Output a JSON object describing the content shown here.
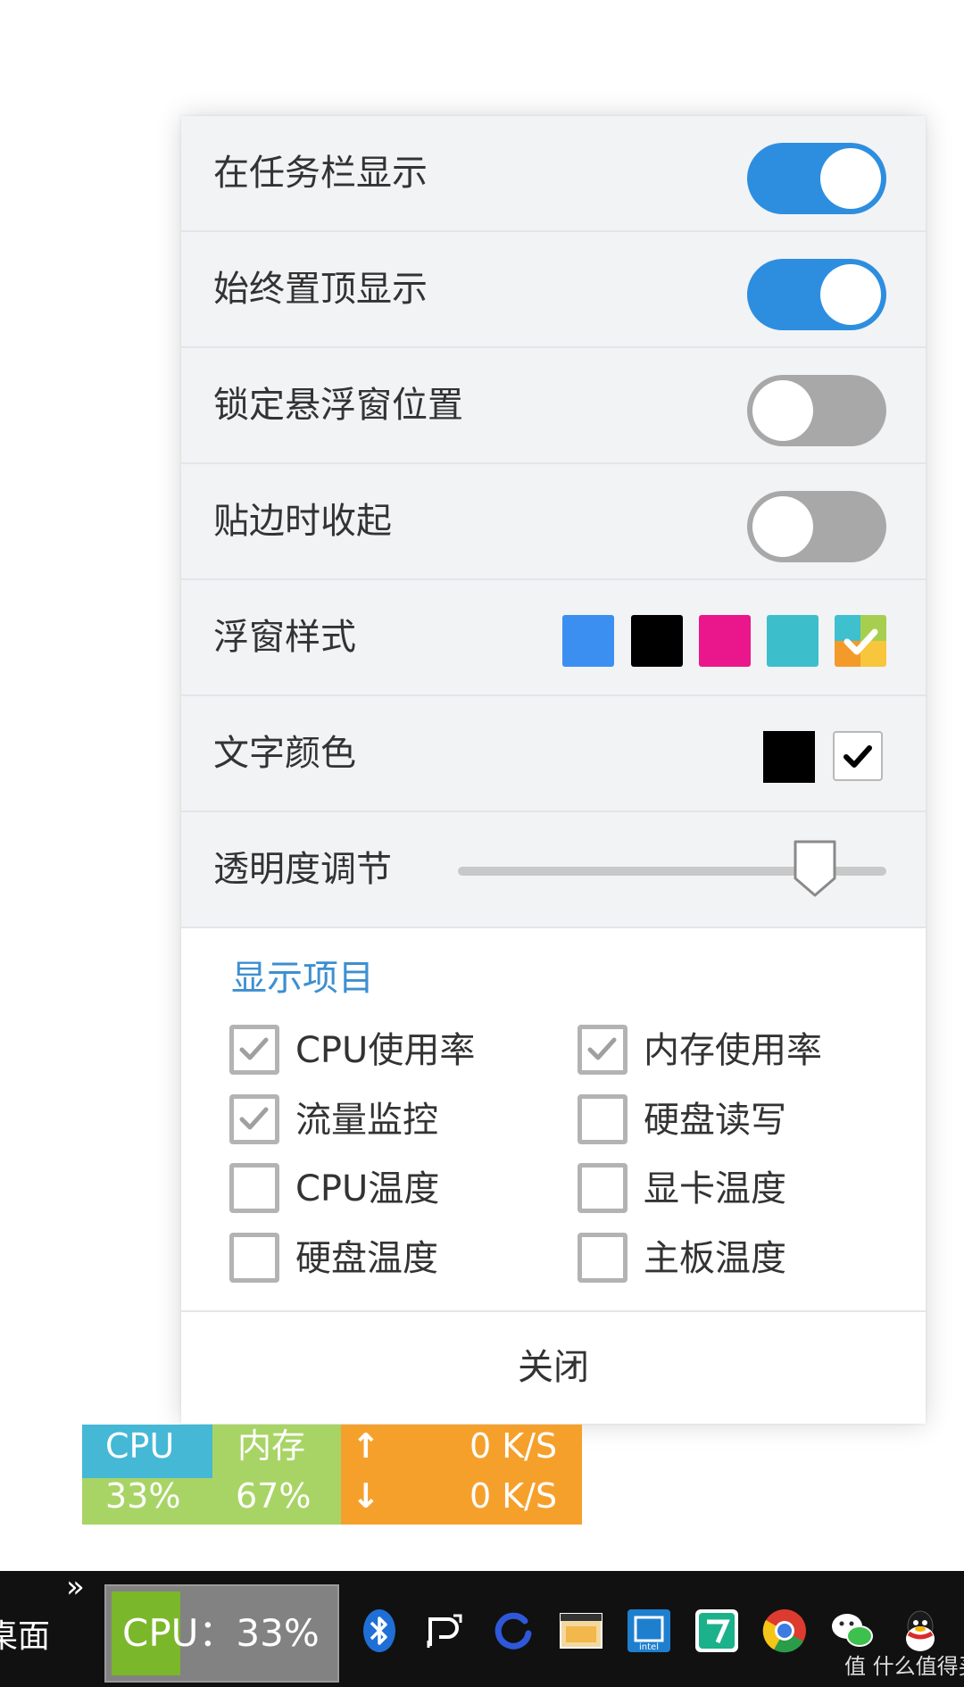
{
  "panel": {
    "toggles": [
      {
        "label": "在任务栏显示",
        "state": "on"
      },
      {
        "label": "始终置顶显示",
        "state": "on"
      },
      {
        "label": "锁定悬浮窗位置",
        "state": "off"
      },
      {
        "label": "贴边时收起",
        "state": "off"
      }
    ],
    "style_row": {
      "label": "浮窗样式",
      "swatches": [
        "#3b8ff0",
        "#000000",
        "#ea168b",
        "#3dbfcb"
      ],
      "selected_swatch_icon": "multicolor-checked-swatch-icon"
    },
    "text_color_row": {
      "label": "文字颜色",
      "options": [
        "#000000",
        "#ffffff"
      ],
      "selected": "#ffffff"
    },
    "opacity_row": {
      "label": "透明度调节",
      "value_fraction": 0.78
    },
    "display_items": {
      "title": "显示项目",
      "items": [
        {
          "label": "CPU使用率",
          "checked": true
        },
        {
          "label": "内存使用率",
          "checked": true
        },
        {
          "label": "流量监控",
          "checked": true
        },
        {
          "label": "硬盘读写",
          "checked": false
        },
        {
          "label": "CPU温度",
          "checked": false
        },
        {
          "label": "显卡温度",
          "checked": false
        },
        {
          "label": "硬盘温度",
          "checked": false
        },
        {
          "label": "主板温度",
          "checked": false
        }
      ]
    },
    "close_label": "关闭"
  },
  "monitor": {
    "cpu_label": "CPU",
    "cpu_value": "33%",
    "mem_label": "内存",
    "mem_value": "67%",
    "up_arrow": "↑",
    "down_arrow": "↓",
    "upload": "0 K/S",
    "download": "0 K/S"
  },
  "taskbar": {
    "chevron": "»",
    "desktop_label": "桌面",
    "cpu_widget": "CPU：33%",
    "tray_icons": [
      "bluetooth-icon",
      "p-app-icon",
      "circle-app-icon",
      "window-app-icon",
      "intel-app-icon",
      "green-app-icon",
      "chrome-icon",
      "wechat-icon",
      "qq-icon"
    ]
  },
  "watermark": "值 什么值得买"
}
